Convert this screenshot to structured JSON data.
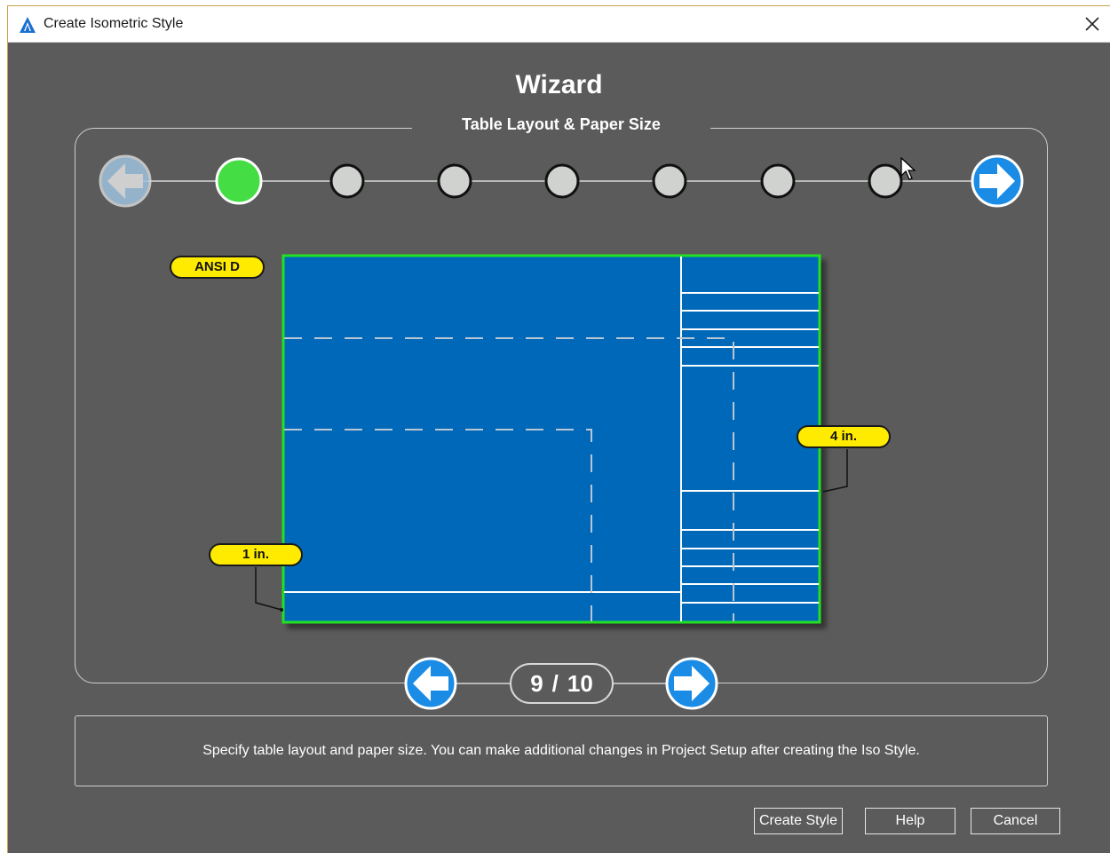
{
  "window": {
    "title": "Create Isometric Style"
  },
  "wizard": {
    "title": "Wizard",
    "step_title": "Table Layout & Paper Size",
    "steps_total_dots": 7,
    "active_dot": 0
  },
  "preview": {
    "paper_size_label": "ANSI D",
    "right_margin_label": "4 in.",
    "bottom_margin_label": "1 in.",
    "colors": {
      "paper": "#0068b8",
      "border": "#20e020",
      "callout": "#ffeb00"
    }
  },
  "pager": {
    "current": "9",
    "separator": "/",
    "total": "10"
  },
  "description": "Specify table layout and paper size.  You can make additional changes in Project Setup after creating the Iso Style.",
  "buttons": {
    "create_style": "Create Style",
    "help": "Help",
    "cancel": "Cancel"
  },
  "icons": {
    "app": "autocad-plant-icon",
    "close": "close-icon",
    "back": "arrow-left-icon",
    "forward": "arrow-right-icon"
  },
  "colors": {
    "background": "#5b5b5b",
    "active_step": "#44dd44",
    "inactive_step": "#cfd2cf",
    "arrow_blue": "#1a8ce6"
  }
}
